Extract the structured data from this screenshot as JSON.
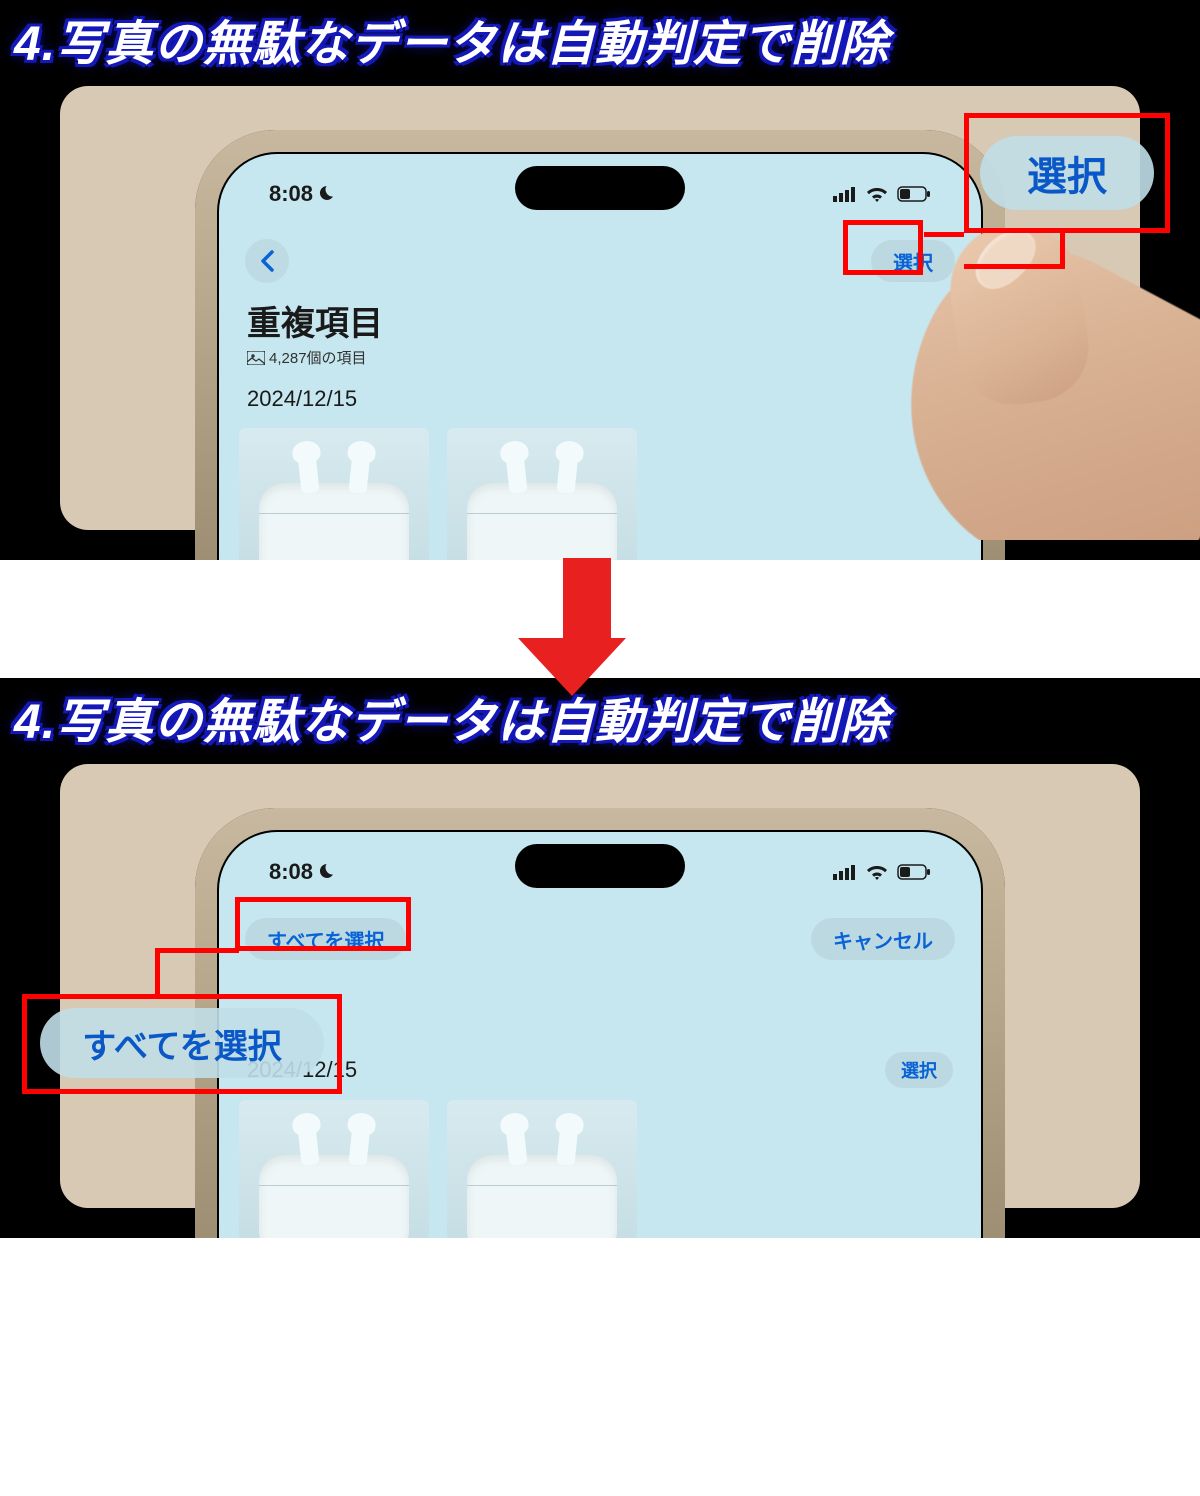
{
  "heading": "4.写真の無駄なデータは自動判定で削除",
  "status": {
    "time": "8:08"
  },
  "screen1": {
    "title": "重複項目",
    "item_count": "4,287個の項目",
    "select_btn": "選択",
    "date": "2024/12/15",
    "callout": "選択"
  },
  "screen2": {
    "select_all_btn": "すべてを選択",
    "cancel_btn": "キャンセル",
    "date": "2024/12/15",
    "row_select_btn": "選択",
    "callout": "すべてを選択"
  }
}
